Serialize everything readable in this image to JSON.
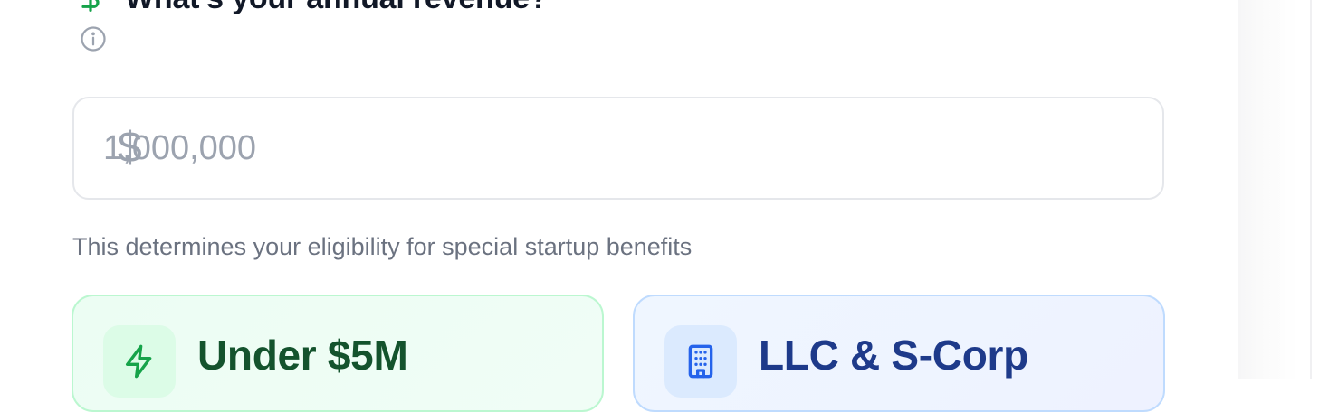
{
  "question": {
    "icon": "dollar-icon",
    "text": "What's your annual revenue?",
    "info_icon": "info-icon"
  },
  "revenue_input": {
    "prefix": "$",
    "placeholder": "1,000,000",
    "value": ""
  },
  "helper_text": "This determines your eligibility for special startup benefits",
  "cards": [
    {
      "icon": "lightning-icon",
      "title": "Under $5M",
      "theme": "green"
    },
    {
      "icon": "building-icon",
      "title": "LLC & S-Corp",
      "theme": "blue"
    }
  ],
  "colors": {
    "accent_green": "#16a34a",
    "accent_blue": "#2563eb",
    "card_green_bg": "#ecfdf3",
    "card_blue_bg": "#eff6ff",
    "title_green": "#14532d",
    "title_blue": "#1e3a8a"
  }
}
